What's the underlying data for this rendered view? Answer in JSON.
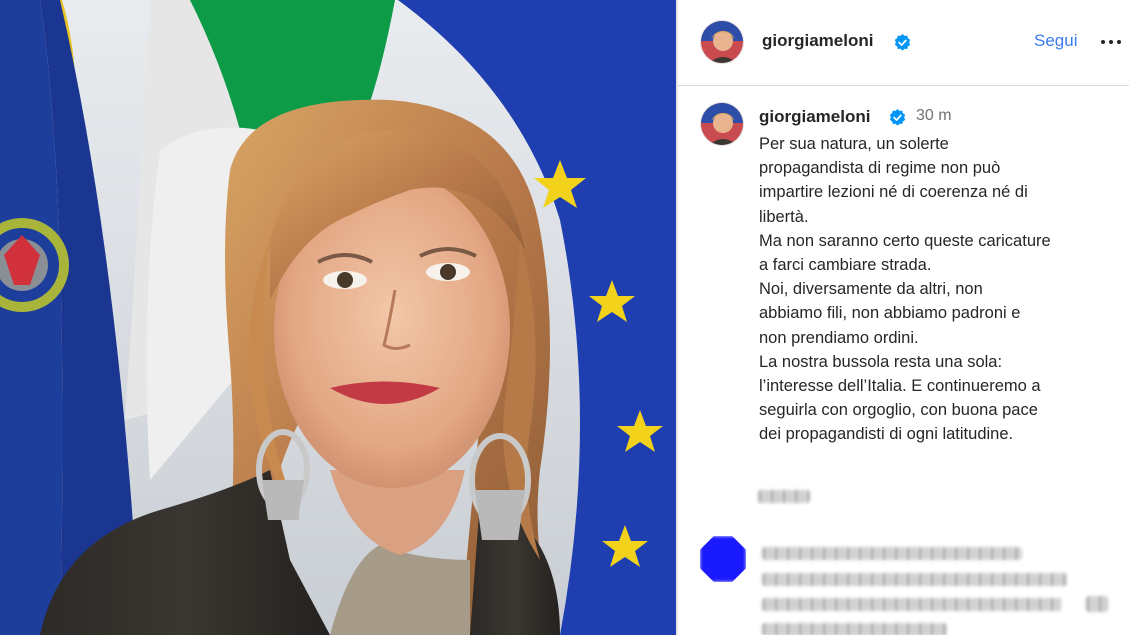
{
  "post": {
    "author": {
      "username": "giorgiameloni",
      "verified_icon": "verified-badge-icon"
    },
    "follow_label": "Segui",
    "more_icon": "more-options-icon",
    "caption": {
      "time": "30 m",
      "lines": [
        "Per sua natura, un solerte",
        "propagandista di regime non può",
        "impartire lezioni né di coerenza né di",
        "libertà.",
        "Ma non saranno certo queste caricature",
        "a farci cambiare strada.",
        "Noi, diversamente da altri, non",
        "abbiamo fili, non abbiamo padroni e",
        "non prendiamo ordini.",
        "La nostra bussola resta una sola:",
        "l’interesse dell’Italia. E continueremo a",
        "seguirla con orgoglio, con buona pace",
        "dei propagandisti di ogni latitudine."
      ]
    }
  },
  "colors": {
    "accent": "#3b7bf0",
    "verified": "#0095f6",
    "text": "#262626",
    "muted": "#737373",
    "eu_flag": "#1f3fb0",
    "flag_green": "#0d9b48",
    "flag_red": "#cf2b37"
  }
}
